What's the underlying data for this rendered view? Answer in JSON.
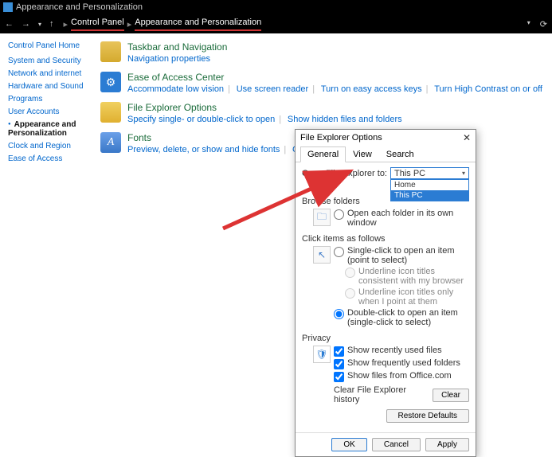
{
  "window_title": "Appearance and Personalization",
  "breadcrumb": {
    "a": "Control Panel",
    "b": "Appearance and Personalization"
  },
  "sidebar": {
    "home": "Control Panel Home",
    "items": [
      "System and Security",
      "Network and internet",
      "Hardware and Sound",
      "Programs",
      "User Accounts",
      "Appearance and Personalization",
      "Clock and Region",
      "Ease of Access"
    ]
  },
  "cats": [
    {
      "title": "Taskbar and Navigation",
      "links": [
        "Navigation properties"
      ]
    },
    {
      "title": "Ease of Access Center",
      "links": [
        "Accommodate low vision",
        "Use screen reader",
        "Turn on easy access keys",
        "Turn High Contrast on or off"
      ]
    },
    {
      "title": "File Explorer Options",
      "links": [
        "Specify single- or double-click to open",
        "Show hidden files and folders"
      ]
    },
    {
      "title": "Fonts",
      "links": [
        "Preview, delete, or show and hide fonts",
        "Change Font Settings"
      ]
    }
  ],
  "dlg": {
    "title": "File Explorer Options",
    "tabs": [
      "General",
      "View",
      "Search"
    ],
    "open_lbl": "Open File Explorer to:",
    "open_sel": "This PC",
    "open_opts": [
      "Home",
      "This PC"
    ],
    "browse_lbl": "Browse folders",
    "browse_b": "Open each folder in its own window",
    "click_lbl": "Click items as follows",
    "click_a": "Single-click to open an item (point to select)",
    "click_a1": "Underline icon titles consistent with my browser",
    "click_a2": "Underline icon titles only when I point at them",
    "click_b": "Double-click to open an item (single-click to select)",
    "priv_lbl": "Privacy",
    "priv_a": "Show recently used files",
    "priv_b": "Show frequently used folders",
    "priv_c": "Show files from Office.com",
    "clear_lbl": "Clear File Explorer history",
    "clear_btn": "Clear",
    "restore": "Restore Defaults",
    "ok": "OK",
    "cancel": "Cancel",
    "apply": "Apply"
  }
}
